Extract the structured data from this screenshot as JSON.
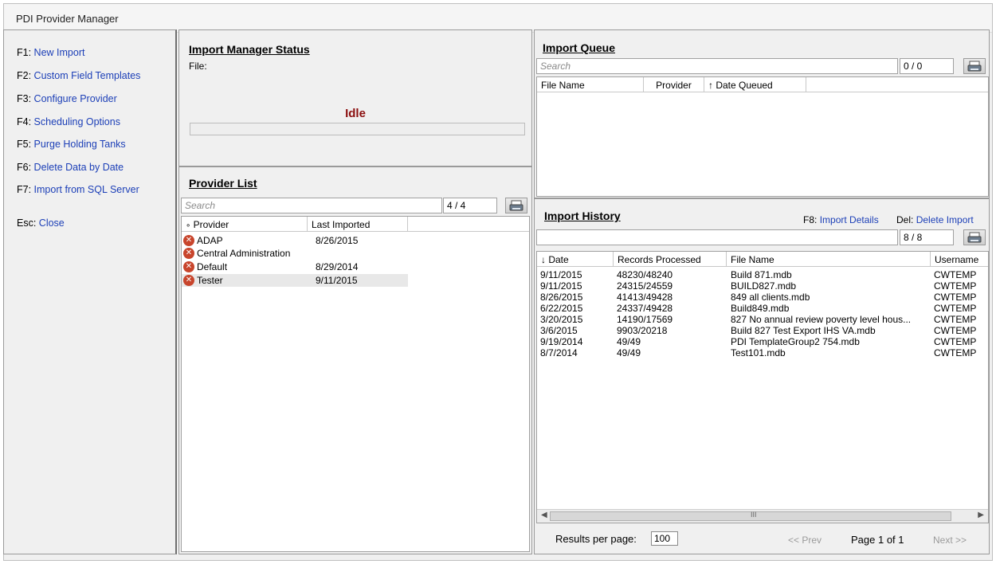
{
  "window": {
    "title": "PDI Provider Manager"
  },
  "sidebar": {
    "items": [
      {
        "key": "F1:",
        "label": "New Import"
      },
      {
        "key": "F2:",
        "label": "Custom Field Templates"
      },
      {
        "key": "F3:",
        "label": "Configure Provider"
      },
      {
        "key": "F4:",
        "label": "Scheduling Options"
      },
      {
        "key": "F5:",
        "label": "Purge Holding Tanks"
      },
      {
        "key": "F6:",
        "label": "Delete Data by Date"
      },
      {
        "key": "F7:",
        "label": "Import from SQL Server"
      },
      {
        "key": "Esc:",
        "label": "Close"
      }
    ]
  },
  "status": {
    "title": "Import Manager Status",
    "file_label": "File:",
    "state": "Idle"
  },
  "provider_list": {
    "title": "Provider List",
    "search_placeholder": "Search",
    "count": "4 / 4",
    "columns": [
      "Provider",
      "Last Imported"
    ],
    "sort_marker": "∘",
    "rows": [
      {
        "provider": "ADAP",
        "last_imported": "8/26/2015",
        "icon": "error-icon"
      },
      {
        "provider": "Central Administration",
        "last_imported": "",
        "icon": "error-icon"
      },
      {
        "provider": "Default",
        "last_imported": "8/29/2014",
        "icon": "error-icon"
      },
      {
        "provider": "Tester",
        "last_imported": "9/11/2015",
        "icon": "error-icon"
      }
    ]
  },
  "queue": {
    "title": "Import Queue",
    "search_placeholder": "Search",
    "count": "0 / 0",
    "columns": [
      "File Name",
      "Provider",
      "↑  Date Queued"
    ]
  },
  "history": {
    "title": "Import History",
    "details_key": "F8:",
    "details_label": "Import Details",
    "delete_key": "Del:",
    "delete_label": "Delete Import",
    "search_value": "",
    "count": "8 / 8",
    "columns": [
      "↓  Date",
      "Records Processed",
      "File Name",
      "Username"
    ],
    "rows": [
      {
        "date": "9/11/2015",
        "records": "48230/48240",
        "file": "Build 871.mdb",
        "user": "CWTEMP"
      },
      {
        "date": "9/11/2015",
        "records": "24315/24559",
        "file": "BUILD827.mdb",
        "user": "CWTEMP"
      },
      {
        "date": "8/26/2015",
        "records": "41413/49428",
        "file": "849 all clients.mdb",
        "user": "CWTEMP"
      },
      {
        "date": "6/22/2015",
        "records": "24337/49428",
        "file": "Build849.mdb",
        "user": "CWTEMP"
      },
      {
        "date": "3/20/2015",
        "records": "14190/17569",
        "file": "827 No annual review poverty level hous...",
        "user": "CWTEMP"
      },
      {
        "date": "3/6/2015",
        "records": "9903/20218",
        "file": "Build 827 Test Export IHS VA.mdb",
        "user": "CWTEMP"
      },
      {
        "date": "9/19/2014",
        "records": "49/49",
        "file": "PDI TemplateGroup2 754.mdb",
        "user": "CWTEMP"
      },
      {
        "date": "8/7/2014",
        "records": "49/49",
        "file": "Test101.mdb",
        "user": "CWTEMP"
      }
    ],
    "scroll_grip": "III",
    "results_label": "Results per page:",
    "results_value": "100",
    "prev_label": "<< Prev",
    "page_info": "Page 1 of 1",
    "next_label": "Next >>"
  }
}
